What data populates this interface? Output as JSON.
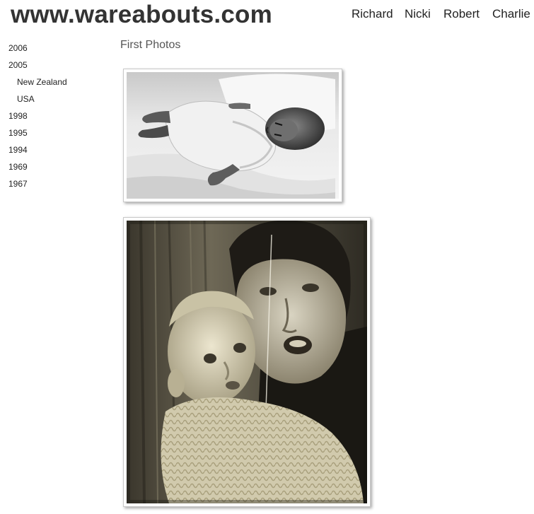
{
  "header": {
    "site_title": "www.wareabouts.com",
    "nav": [
      "Richard",
      "Nicki",
      "Robert",
      "Charlie"
    ]
  },
  "sidebar": {
    "items": [
      {
        "label": "2006",
        "level": 0
      },
      {
        "label": "2005",
        "level": 0
      },
      {
        "label": "New Zealand",
        "level": 1
      },
      {
        "label": "USA",
        "level": 1
      },
      {
        "label": "1998",
        "level": 0
      },
      {
        "label": "1995",
        "level": 0
      },
      {
        "label": "1994",
        "level": 0
      },
      {
        "label": "1969",
        "level": 0
      },
      {
        "label": "1967",
        "level": 0
      }
    ]
  },
  "main": {
    "section_title": "First Photos",
    "photos": [
      {
        "subject": "black-and-white photo of newborn baby lying on blanket",
        "style": "monochrome"
      },
      {
        "subject": "sepia photo of man holding baby in knitted sweater",
        "style": "sepia"
      }
    ]
  }
}
